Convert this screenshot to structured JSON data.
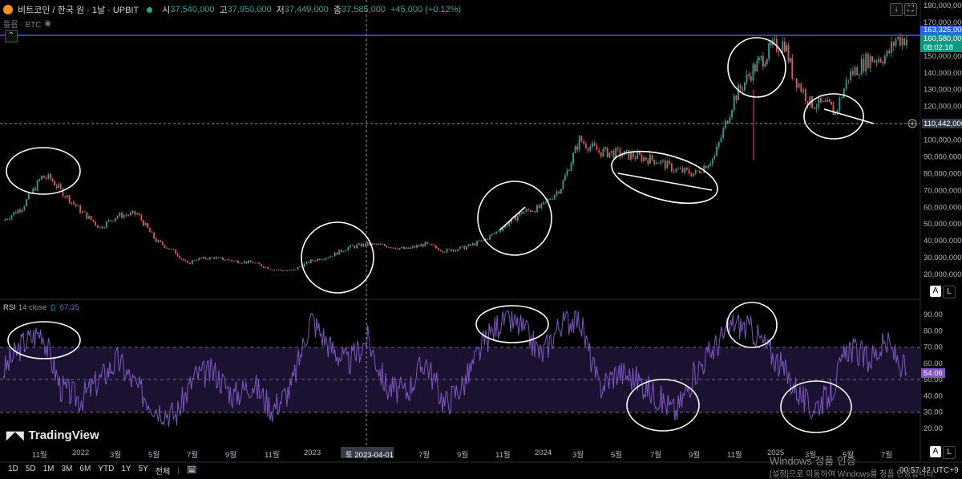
{
  "header": {
    "symbol": "비트코인 / 한국 원 · 1날 · UPBIT",
    "open_k": "시",
    "open_v": "37,540,000",
    "high_k": "고",
    "high_v": "37,950,000",
    "low_k": "저",
    "low_v": "37,449,000",
    "close_k": "종",
    "close_v": "37,585,000",
    "change": "+45,000 (+0.12%)",
    "volume_label": "틀름 · BTC"
  },
  "price_tags": {
    "upper_line": "163,325,000",
    "last_price": "160,580,000",
    "countdown": "08:02:18",
    "crosshair": "110,442,000"
  },
  "rsi": {
    "label": "RSI",
    "params": "14 close",
    "value": "67.35",
    "last_tag": "54.06"
  },
  "crosshair_date": "토 2023-04-01",
  "time_labels": [
    {
      "label": "11월",
      "x": 48
    },
    {
      "label": "2022",
      "x": 98
    },
    {
      "label": "3월",
      "x": 145
    },
    {
      "label": "5월",
      "x": 193
    },
    {
      "label": "7월",
      "x": 241
    },
    {
      "label": "9월",
      "x": 289
    },
    {
      "label": "11월",
      "x": 338
    },
    {
      "label": "2023",
      "x": 387
    },
    {
      "label": "7월",
      "x": 530
    },
    {
      "label": "9월",
      "x": 578
    },
    {
      "label": "11월",
      "x": 626
    },
    {
      "label": "2024",
      "x": 675
    },
    {
      "label": "3월",
      "x": 722
    },
    {
      "label": "5월",
      "x": 770
    },
    {
      "label": "7월",
      "x": 819
    },
    {
      "label": "9월",
      "x": 867
    },
    {
      "label": "11월",
      "x": 915
    },
    {
      "label": "2025",
      "x": 965
    },
    {
      "label": "3월",
      "x": 1012
    },
    {
      "label": "5월",
      "x": 1059
    },
    {
      "label": "7월",
      "x": 1107
    }
  ],
  "timeframes": [
    "1D",
    "5D",
    "1M",
    "3M",
    "6M",
    "YTD",
    "1Y",
    "5Y",
    "전체"
  ],
  "clock": "00:57:42 UTC+9",
  "branding": "TradingView",
  "windows_activation": {
    "line1": "Windows 정품 인증",
    "line2": "[설정]으로 이동하여 Windows를 정품 인증합니다."
  },
  "buttons": {
    "auto": "A",
    "log": "L"
  },
  "colors": {
    "up": "#26a69a",
    "down": "#ef5350",
    "rsi": "#7e57c2",
    "rsi_band": "#1d1530",
    "blue_line": "#2962ff",
    "annotation": "#ffffff"
  },
  "chart_data": [
    {
      "type": "candlestick",
      "title": "",
      "xlabel": "",
      "ylabel": "",
      "currency": "KRW",
      "ylim": [
        10000000,
        185000000
      ],
      "y_ticks": [
        20000000,
        30000000,
        40000000,
        50000000,
        60000000,
        70000000,
        80000000,
        90000000,
        100000000,
        110000000,
        120000000,
        130000000,
        140000000,
        150000000,
        160000000,
        170000000,
        180000000
      ],
      "y_tick_labels": [
        "20,000,000",
        "30,000,000",
        "40,000,000",
        "50,000,000",
        "60,000,000",
        "70,000,000",
        "80,000,000",
        "90,000,000",
        "100,000,000",
        "110,000,000",
        "120,000,000",
        "130,000,000",
        "140,000,000",
        "150,000,000",
        "160,000,000",
        "170,000,000",
        "180,000,000"
      ],
      "horizontal_line": 163325000,
      "last_price": 160580000,
      "crosshair_price": 110442000,
      "crosshair_date": "2023-04-01",
      "x": [
        "2021-09-01",
        "2021-10-01",
        "2021-11-01",
        "2021-11-15",
        "2021-12-01",
        "2022-01-01",
        "2022-02-01",
        "2022-03-01",
        "2022-04-01",
        "2022-05-01",
        "2022-06-01",
        "2022-06-20",
        "2022-07-01",
        "2022-08-01",
        "2022-09-01",
        "2022-10-01",
        "2022-11-01",
        "2022-12-01",
        "2023-01-01",
        "2023-02-01",
        "2023-03-01",
        "2023-04-01",
        "2023-05-01",
        "2023-06-01",
        "2023-07-01",
        "2023-08-01",
        "2023-09-01",
        "2023-10-01",
        "2023-11-01",
        "2023-12-01",
        "2024-01-01",
        "2024-02-01",
        "2024-03-01",
        "2024-04-01",
        "2024-05-01",
        "2024-06-01",
        "2024-07-01",
        "2024-08-01",
        "2024-09-01",
        "2024-10-01",
        "2024-11-01",
        "2024-12-01",
        "2024-12-20",
        "2025-01-01",
        "2025-01-20",
        "2025-02-01",
        "2025-03-01",
        "2025-04-01",
        "2025-04-10",
        "2025-05-01",
        "2025-06-01",
        "2025-07-01",
        "2025-07-15",
        "2025-08-01"
      ],
      "close": [
        52000000,
        60000000,
        78000000,
        77000000,
        70000000,
        58000000,
        48000000,
        55000000,
        56000000,
        40000000,
        33000000,
        26000000,
        29000000,
        30000000,
        28000000,
        27000000,
        23000000,
        22000000,
        28000000,
        31000000,
        36000000,
        38000000,
        37000000,
        35000000,
        38000000,
        34000000,
        36000000,
        40000000,
        48000000,
        57000000,
        60000000,
        72000000,
        100000000,
        93000000,
        92000000,
        90000000,
        88000000,
        82000000,
        80000000,
        90000000,
        125000000,
        142000000,
        150000000,
        155000000,
        158000000,
        140000000,
        122000000,
        120000000,
        116000000,
        138000000,
        148000000,
        150000000,
        160000000,
        160580000
      ]
    },
    {
      "type": "line",
      "title": "",
      "ylabel": "",
      "ylim": [
        20,
        95
      ],
      "y_ticks": [
        20,
        30,
        40,
        50,
        60,
        70,
        80,
        90
      ],
      "y_tick_labels": [
        "20.00",
        "30.00",
        "40.00",
        "50.00",
        "60.00",
        "70.00",
        "80.00",
        "90.00"
      ],
      "bands": {
        "upper": 70,
        "middle": 50,
        "lower": 30
      },
      "series": [
        {
          "name": "RSI 14 close",
          "x": [
            "2021-09-01",
            "2021-10-01",
            "2021-11-01",
            "2021-12-01",
            "2022-01-01",
            "2022-02-01",
            "2022-03-01",
            "2022-04-01",
            "2022-05-01",
            "2022-06-01",
            "2022-07-01",
            "2022-08-01",
            "2022-09-01",
            "2022-10-01",
            "2022-11-01",
            "2022-12-01",
            "2023-01-01",
            "2023-02-01",
            "2023-03-01",
            "2023-04-01",
            "2023-05-01",
            "2023-06-01",
            "2023-07-01",
            "2023-08-01",
            "2023-09-01",
            "2023-10-01",
            "2023-11-01",
            "2023-12-01",
            "2024-01-01",
            "2024-02-01",
            "2024-03-01",
            "2024-04-01",
            "2024-05-01",
            "2024-06-01",
            "2024-07-01",
            "2024-08-01",
            "2024-09-01",
            "2024-10-01",
            "2024-11-01",
            "2024-12-01",
            "2025-01-01",
            "2025-02-01",
            "2025-03-01",
            "2025-04-01",
            "2025-05-01",
            "2025-06-01",
            "2025-07-01",
            "2025-08-01"
          ],
          "values": [
            55,
            72,
            80,
            45,
            38,
            50,
            62,
            45,
            33,
            28,
            52,
            55,
            40,
            48,
            32,
            45,
            88,
            70,
            60,
            75,
            45,
            42,
            62,
            35,
            48,
            72,
            88,
            82,
            65,
            85,
            88,
            45,
            55,
            50,
            40,
            30,
            55,
            70,
            85,
            80,
            65,
            48,
            32,
            40,
            70,
            62,
            72,
            54.06
          ]
        }
      ]
    }
  ]
}
